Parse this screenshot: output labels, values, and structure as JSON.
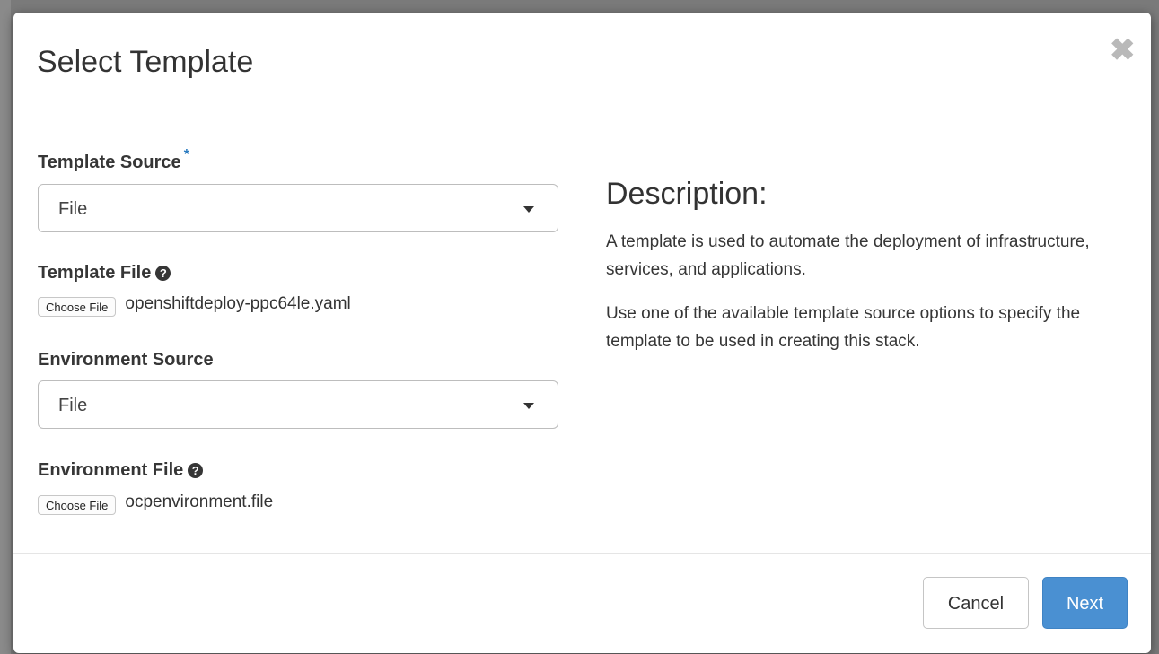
{
  "modal": {
    "title": "Select Template",
    "close_glyph": "✖"
  },
  "form": {
    "template_source": {
      "label": "Template Source",
      "required_marker": "*",
      "selected": "File"
    },
    "template_file": {
      "label": "Template File",
      "help_glyph": "?",
      "choose_label": "Choose File",
      "file_name": "openshiftdeploy-ppc64le.yaml"
    },
    "environment_source": {
      "label": "Environment Source",
      "selected": "File"
    },
    "environment_file": {
      "label": "Environment File",
      "help_glyph": "?",
      "choose_label": "Choose File",
      "file_name": "ocpenvironment.file"
    }
  },
  "description": {
    "title": "Description:",
    "paragraphs": [
      "A template is used to automate the deployment of infrastructure, services, and applications.",
      "Use one of the available template source options to specify the template to be used in creating this stack."
    ]
  },
  "footer": {
    "cancel_label": "Cancel",
    "next_label": "Next"
  },
  "colors": {
    "primary": "#4a90d2",
    "required": "#2a7bc0",
    "overlay": "#7a7a7a"
  },
  "icons": {
    "close": "close-icon",
    "help": "question-circle-icon",
    "caret": "caret-down-icon"
  }
}
